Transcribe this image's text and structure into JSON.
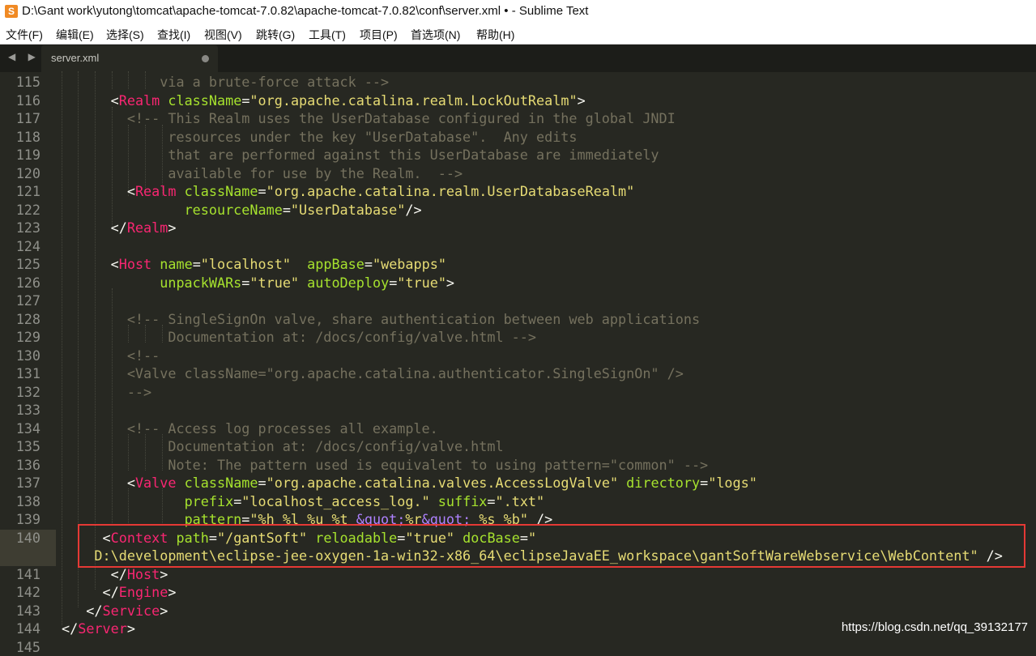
{
  "window": {
    "title": "D:\\Gant work\\yutong\\tomcat\\apache-tomcat-7.0.82\\apache-tomcat-7.0.82\\conf\\server.xml • - Sublime Text",
    "app_icon": "S"
  },
  "menu": [
    "文件(F)",
    "编辑(E)",
    "选择(S)",
    "查找(I)",
    "视图(V)",
    "跳转(G)",
    "工具(T)",
    "项目(P)",
    "首选项(N)",
    "帮助(H)"
  ],
  "tabs": {
    "nav_arrows": "◀ ▶",
    "active_tab": "server.xml"
  },
  "editor": {
    "lines": [
      {
        "num": "115",
        "segs": [
          [
            "c",
            "            via a brute-force attack -->"
          ]
        ]
      },
      {
        "num": "116",
        "segs": [
          [
            "p",
            "      <"
          ],
          [
            "tg",
            "Realm"
          ],
          [
            "p",
            " "
          ],
          [
            "at",
            "className"
          ],
          [
            "p",
            "="
          ],
          [
            "st",
            "\"org.apache.catalina.realm.LockOutRealm\""
          ],
          [
            "p",
            ">"
          ]
        ]
      },
      {
        "num": "117",
        "segs": [
          [
            "c",
            "        <!-- This Realm uses the UserDatabase configured in the global JNDI"
          ]
        ]
      },
      {
        "num": "118",
        "segs": [
          [
            "c",
            "             resources under the key \"UserDatabase\".  Any edits"
          ]
        ]
      },
      {
        "num": "119",
        "segs": [
          [
            "c",
            "             that are performed against this UserDatabase are immediately"
          ]
        ]
      },
      {
        "num": "120",
        "segs": [
          [
            "c",
            "             available for use by the Realm.  -->"
          ]
        ]
      },
      {
        "num": "121",
        "segs": [
          [
            "p",
            "        <"
          ],
          [
            "tg",
            "Realm"
          ],
          [
            "p",
            " "
          ],
          [
            "at",
            "className"
          ],
          [
            "p",
            "="
          ],
          [
            "st",
            "\"org.apache.catalina.realm.UserDatabaseRealm\""
          ]
        ]
      },
      {
        "num": "122",
        "segs": [
          [
            "p",
            "               "
          ],
          [
            "at",
            "resourceName"
          ],
          [
            "p",
            "="
          ],
          [
            "st",
            "\"UserDatabase\""
          ],
          [
            "p",
            "/>"
          ]
        ]
      },
      {
        "num": "123",
        "segs": [
          [
            "p",
            "      </"
          ],
          [
            "tg",
            "Realm"
          ],
          [
            "p",
            ">"
          ]
        ]
      },
      {
        "num": "124",
        "segs": [
          [
            "p",
            ""
          ]
        ]
      },
      {
        "num": "125",
        "segs": [
          [
            "p",
            "      <"
          ],
          [
            "tg",
            "Host"
          ],
          [
            "p",
            " "
          ],
          [
            "at",
            "name"
          ],
          [
            "p",
            "="
          ],
          [
            "st",
            "\"localhost\""
          ],
          [
            "p",
            "  "
          ],
          [
            "at",
            "appBase"
          ],
          [
            "p",
            "="
          ],
          [
            "st",
            "\"webapps\""
          ]
        ]
      },
      {
        "num": "126",
        "segs": [
          [
            "p",
            "            "
          ],
          [
            "at",
            "unpackWARs"
          ],
          [
            "p",
            "="
          ],
          [
            "st",
            "\"true\""
          ],
          [
            "p",
            " "
          ],
          [
            "at",
            "autoDeploy"
          ],
          [
            "p",
            "="
          ],
          [
            "st",
            "\"true\""
          ],
          [
            "p",
            ">"
          ]
        ]
      },
      {
        "num": "127",
        "segs": [
          [
            "p",
            ""
          ]
        ]
      },
      {
        "num": "128",
        "segs": [
          [
            "c",
            "        <!-- SingleSignOn valve, share authentication between web applications"
          ]
        ]
      },
      {
        "num": "129",
        "segs": [
          [
            "c",
            "             Documentation at: /docs/config/valve.html -->"
          ]
        ]
      },
      {
        "num": "130",
        "segs": [
          [
            "c",
            "        <!--"
          ]
        ]
      },
      {
        "num": "131",
        "segs": [
          [
            "c",
            "        <Valve className=\"org.apache.catalina.authenticator.SingleSignOn\" />"
          ]
        ]
      },
      {
        "num": "132",
        "segs": [
          [
            "c",
            "        -->"
          ]
        ]
      },
      {
        "num": "133",
        "segs": [
          [
            "p",
            ""
          ]
        ]
      },
      {
        "num": "134",
        "segs": [
          [
            "c",
            "        <!-- Access log processes all example."
          ]
        ]
      },
      {
        "num": "135",
        "segs": [
          [
            "c",
            "             Documentation at: /docs/config/valve.html"
          ]
        ]
      },
      {
        "num": "136",
        "segs": [
          [
            "c",
            "             Note: The pattern used is equivalent to using pattern=\"common\" -->"
          ]
        ]
      },
      {
        "num": "137",
        "segs": [
          [
            "p",
            "        <"
          ],
          [
            "tg",
            "Valve"
          ],
          [
            "p",
            " "
          ],
          [
            "at",
            "className"
          ],
          [
            "p",
            "="
          ],
          [
            "st",
            "\"org.apache.catalina.valves.AccessLogValve\""
          ],
          [
            "p",
            " "
          ],
          [
            "at",
            "directory"
          ],
          [
            "p",
            "="
          ],
          [
            "st",
            "\"logs\""
          ]
        ]
      },
      {
        "num": "138",
        "segs": [
          [
            "p",
            "               "
          ],
          [
            "at",
            "prefix"
          ],
          [
            "p",
            "="
          ],
          [
            "st",
            "\"localhost_access_log.\""
          ],
          [
            "p",
            " "
          ],
          [
            "at",
            "suffix"
          ],
          [
            "p",
            "="
          ],
          [
            "st",
            "\".txt\""
          ]
        ]
      },
      {
        "num": "139",
        "segs": [
          [
            "p",
            "               "
          ],
          [
            "at",
            "pattern"
          ],
          [
            "p",
            "="
          ],
          [
            "st",
            "\"%h %l %u %t "
          ],
          [
            "en",
            "&quot;"
          ],
          [
            "st",
            "%r"
          ],
          [
            "en",
            "&quot;"
          ],
          [
            "st",
            " %s %b\""
          ],
          [
            "p",
            " />"
          ]
        ]
      },
      {
        "num": "140",
        "segs": [
          [
            "p",
            "     <"
          ],
          [
            "tg",
            "Context"
          ],
          [
            "p",
            " "
          ],
          [
            "at",
            "path"
          ],
          [
            "p",
            "="
          ],
          [
            "st",
            "\"/gantSoft\""
          ],
          [
            "p",
            " "
          ],
          [
            "at",
            "reloadable"
          ],
          [
            "p",
            "="
          ],
          [
            "st",
            "\"true\""
          ],
          [
            "p",
            " "
          ],
          [
            "at",
            "docBase"
          ],
          [
            "p",
            "="
          ],
          [
            "st",
            "\""
          ]
        ]
      },
      {
        "num": "",
        "segs": [
          [
            "st",
            "    D:\\development\\eclipse-jee-oxygen-1a-win32-x86_64\\eclipseJavaEE_workspace\\gantSoftWareWebservice\\WebContent\""
          ],
          [
            "p",
            " />"
          ]
        ]
      },
      {
        "num": "141",
        "segs": [
          [
            "p",
            "      </"
          ],
          [
            "tg",
            "Host"
          ],
          [
            "p",
            ">"
          ]
        ]
      },
      {
        "num": "142",
        "segs": [
          [
            "p",
            "     </"
          ],
          [
            "tg",
            "Engine"
          ],
          [
            "p",
            ">"
          ]
        ]
      },
      {
        "num": "143",
        "segs": [
          [
            "p",
            "   </"
          ],
          [
            "tg",
            "Service"
          ],
          [
            "p",
            ">"
          ]
        ]
      },
      {
        "num": "144",
        "segs": [
          [
            "p",
            "</"
          ],
          [
            "tg",
            "Server"
          ],
          [
            "p",
            ">"
          ]
        ]
      },
      {
        "num": "145",
        "segs": [
          [
            "p",
            ""
          ]
        ]
      }
    ]
  },
  "watermark": "https://blog.csdn.net/qq_39132177",
  "colors": {
    "background": "#272822",
    "comment": "#75715e",
    "tag": "#f92672",
    "attribute": "#a6e22e",
    "string": "#e6db74",
    "entity": "#ae81ff",
    "highlight_border": "#e53935"
  }
}
